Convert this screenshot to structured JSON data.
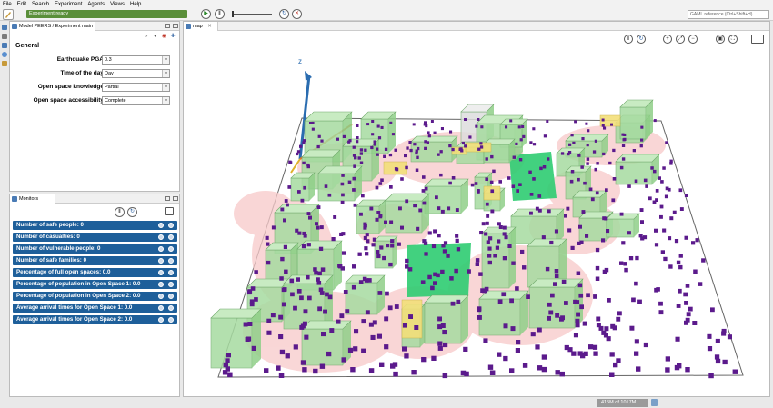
{
  "menu": [
    "File",
    "Edit",
    "Search",
    "Experiment",
    "Agents",
    "Views",
    "Help"
  ],
  "toolbar": {
    "status": "Experiment ready",
    "gaml_reference": "GAML reference (Ctrl+Shift+H)"
  },
  "params": {
    "tab_title": "Model PEERS / Experiment main",
    "section": "General",
    "rows": [
      {
        "label": "Earthquake PGA",
        "value": "0.3"
      },
      {
        "label": "Time of the day",
        "value": "Day"
      },
      {
        "label": "Open space knowledge",
        "value": "Partial"
      },
      {
        "label": "Open space accessibility",
        "value": "Complete"
      }
    ]
  },
  "monitors": {
    "tab_title": "Monitors",
    "rows": [
      "Number of safe people:  0",
      "Number of casualties:  0",
      "Number of vulnerable people:  0",
      "Number of safe families:  0",
      "Percentage of full open spaces:  0.0",
      "Percentage of population in Open Space 1:  0.0",
      "Percentage of population in Open Space 2:  0.0",
      "Average arrival times for Open Space 1:  0.0",
      "Average arrival times for Open Space 2:  0.0"
    ]
  },
  "map": {
    "tab_title": "map",
    "axis_label": "z",
    "colors": {
      "building": "#a6dba0",
      "building_edge": "#6fa86a",
      "open_space": "#2ecc71",
      "agent": "#5b1a8c",
      "ground": "#ffffff",
      "hazard_zone": "#f7c9c9",
      "highlight": "#f3df7a"
    }
  },
  "memory": "415M of 1017M"
}
